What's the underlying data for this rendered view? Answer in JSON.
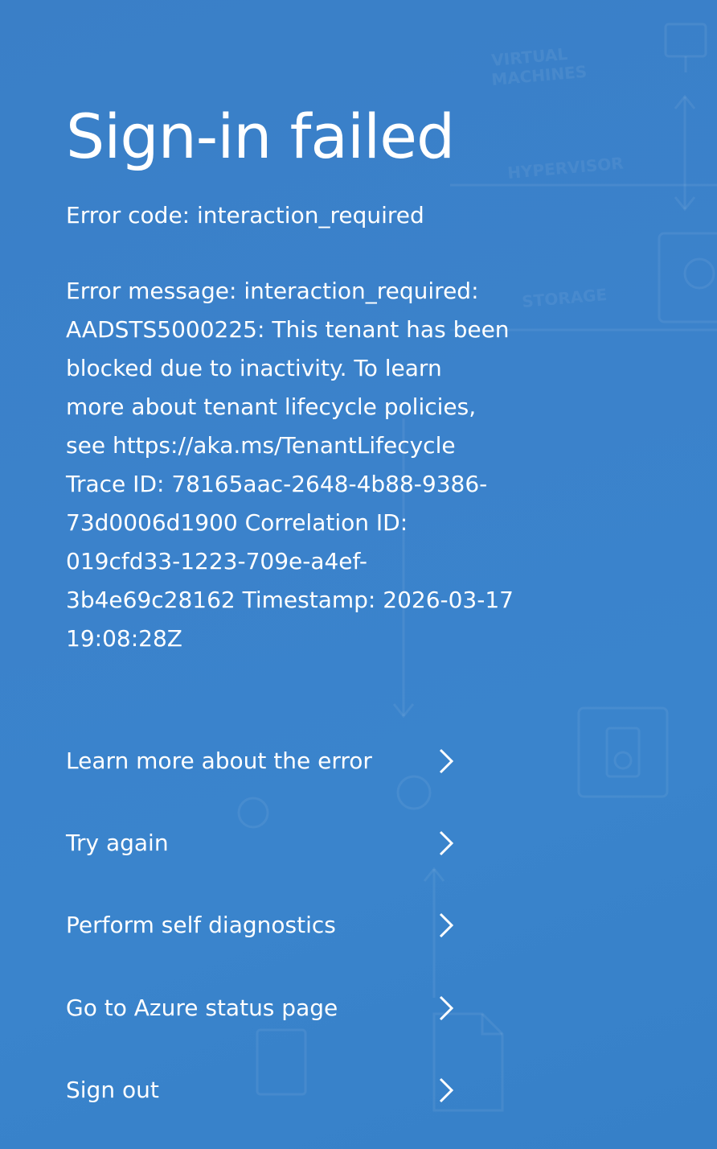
{
  "page": {
    "title": "Sign-in failed",
    "error_code": "Error code: interaction_required",
    "error_message_lines": [
      "Error message: interaction_required:",
      "AADSTS5000225: This tenant has been",
      "blocked due to inactivity. To learn",
      "more about tenant lifecycle policies,",
      "see https://aka.ms/TenantLifecycle",
      "Trace ID: 78165aac-2648-4b88-9386-",
      "73d0006d1900 Correlation ID:",
      "019cfd33-1223-709e-a4ef-",
      "3b4e69c28162 Timestamp: 2026-03-17",
      "19:08:28Z"
    ]
  },
  "actions": [
    {
      "label": "Learn more about the error",
      "icon": "chevron-right-icon"
    },
    {
      "label": "Try again",
      "icon": "chevron-right-icon"
    },
    {
      "label": "Perform self diagnostics",
      "icon": "chevron-right-icon"
    },
    {
      "label": "Go to Azure status page",
      "icon": "chevron-right-icon"
    },
    {
      "label": "Sign out",
      "icon": "chevron-right-icon"
    }
  ],
  "background": {
    "labels": [
      "VIRTUAL MACHINES",
      "HYPERVISOR",
      "STORAGE"
    ]
  },
  "colors": {
    "background": "#3a82ca",
    "text": "#ffffff"
  }
}
